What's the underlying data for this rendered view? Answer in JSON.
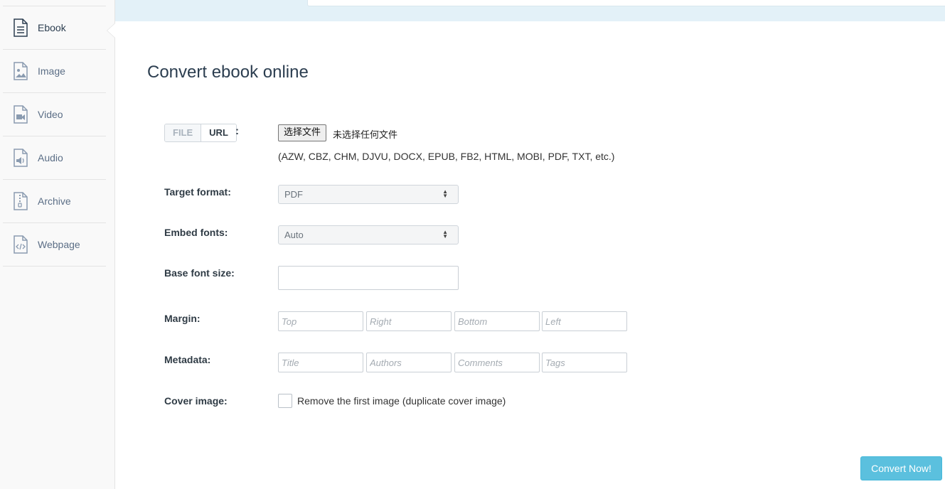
{
  "sidebar": {
    "items": [
      {
        "label": "Ebook",
        "icon": "ebook-icon"
      },
      {
        "label": "Image",
        "icon": "image-icon"
      },
      {
        "label": "Video",
        "icon": "video-icon"
      },
      {
        "label": "Audio",
        "icon": "audio-icon"
      },
      {
        "label": "Archive",
        "icon": "archive-icon"
      },
      {
        "label": "Webpage",
        "icon": "webpage-icon"
      }
    ],
    "active": "Ebook"
  },
  "main": {
    "title": "Convert ebook online",
    "source": {
      "toggle_file": "FILE",
      "toggle_url": "URL",
      "colon": ":",
      "choose_button": "选择文件",
      "file_status": "未选择任何文件",
      "formats_hint": "(AZW, CBZ, CHM, DJVU, DOCX, EPUB, FB2, HTML, MOBI, PDF, TXT, etc.)"
    },
    "target_format": {
      "label": "Target format:",
      "value": "PDF"
    },
    "embed_fonts": {
      "label": "Embed fonts:",
      "value": "Auto"
    },
    "base_font_size": {
      "label": "Base font size:",
      "value": ""
    },
    "margin": {
      "label": "Margin:",
      "placeholders": [
        "Top",
        "Right",
        "Bottom",
        "Left"
      ]
    },
    "metadata": {
      "label": "Metadata:",
      "placeholders": [
        "Title",
        "Authors",
        "Comments",
        "Tags"
      ]
    },
    "cover_image": {
      "label": "Cover image:",
      "checkbox_label": "Remove the first image (duplicate cover image)",
      "checked": false
    },
    "convert_button": "Convert Now!"
  },
  "colors": {
    "accent": "#5bc0de",
    "banner": "#e3f1f8",
    "sidebar_bg": "#f9f9f9"
  }
}
